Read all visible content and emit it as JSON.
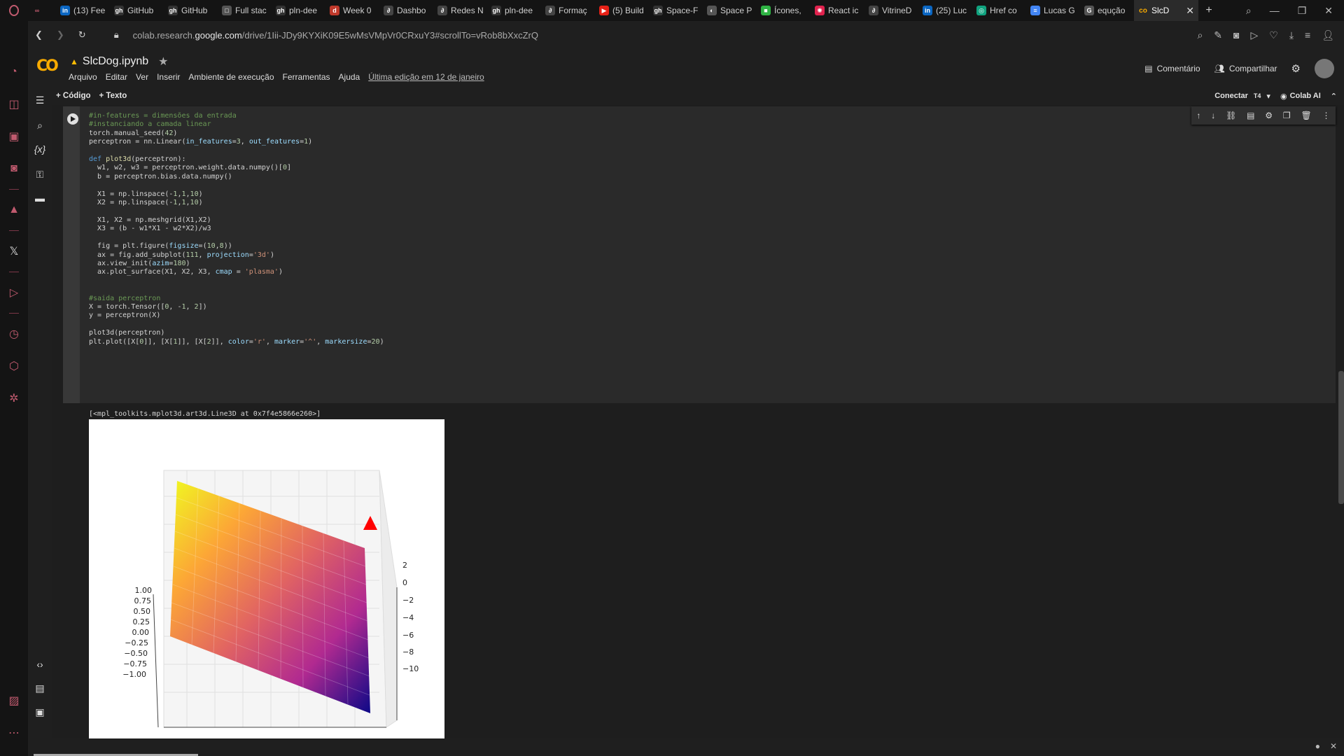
{
  "browser": {
    "tabs": [
      {
        "label": "(13) Fee",
        "fav": "in",
        "color": "#0a66c2"
      },
      {
        "label": "GitHub",
        "fav": "gh",
        "color": "#333"
      },
      {
        "label": "GitHub",
        "fav": "gh",
        "color": "#333"
      },
      {
        "label": "Full stac",
        "fav": "□",
        "color": "#555"
      },
      {
        "label": "pln-dee",
        "fav": "gh",
        "color": "#333"
      },
      {
        "label": "Week 0",
        "fav": "d",
        "color": "#c0392b"
      },
      {
        "label": "Dashbo",
        "fav": "∂",
        "color": "#444"
      },
      {
        "label": "Redes N",
        "fav": "∂",
        "color": "#444"
      },
      {
        "label": "pln-dee",
        "fav": "gh",
        "color": "#333"
      },
      {
        "label": "Formaç",
        "fav": "∂",
        "color": "#444"
      },
      {
        "label": "(5) Build",
        "fav": "▶",
        "color": "#e62117"
      },
      {
        "label": "Space-F",
        "fav": "gh",
        "color": "#333"
      },
      {
        "label": "Space P",
        "fav": "◐",
        "color": "#555"
      },
      {
        "label": "Ícones,",
        "fav": "■",
        "color": "#2fb344"
      },
      {
        "label": "React ic",
        "fav": "✺",
        "color": "#e0234e"
      },
      {
        "label": "VitrineD",
        "fav": "∂",
        "color": "#444"
      },
      {
        "label": "(25) Luc",
        "fav": "in",
        "color": "#0a66c2"
      },
      {
        "label": "Href co",
        "fav": "◎",
        "color": "#10a37f"
      },
      {
        "label": "Lucas G",
        "fav": "≡",
        "color": "#4285f4"
      },
      {
        "label": "equção",
        "fav": "G",
        "color": "#555"
      }
    ],
    "active_tab": {
      "label": "SlcD",
      "fav": "co"
    },
    "new_tab": "+",
    "url_prefix": "colab.research.",
    "url_domain": "google.com",
    "url_rest": "/drive/1Iii-JDy9KYXiK09E5wMsVMpVr0CRxuY3#scrollTo=vRob8bXxcZrQ"
  },
  "colab": {
    "notebook_title": "SlcDog.ipynb",
    "menus": [
      "Arquivo",
      "Editar",
      "Ver",
      "Inserir",
      "Ambiente de execução",
      "Ferramentas",
      "Ajuda"
    ],
    "last_edit": "Última edição em 12 de janeiro",
    "comment_label": "Comentário",
    "share_label": "Compartilhar",
    "toolbar": {
      "add_code": "+ Código",
      "add_text": "+ Texto",
      "connect": "Conectar",
      "runtime": "T4",
      "colab_ai": "Colab AI"
    },
    "output_text": "[<mpl_toolkits.mplot3d.art3d.Line3D at 0x7f4e5866e260>]",
    "plot": {
      "z_ticks": [
        "2",
        "0",
        "−2",
        "−4",
        "−6",
        "−8",
        "−10"
      ],
      "y_ticks": [
        "1.00",
        "0.75",
        "0.50",
        "0.25",
        "0.00",
        "−0.25",
        "−0.50",
        "−0.75",
        "−1.00"
      ]
    }
  }
}
